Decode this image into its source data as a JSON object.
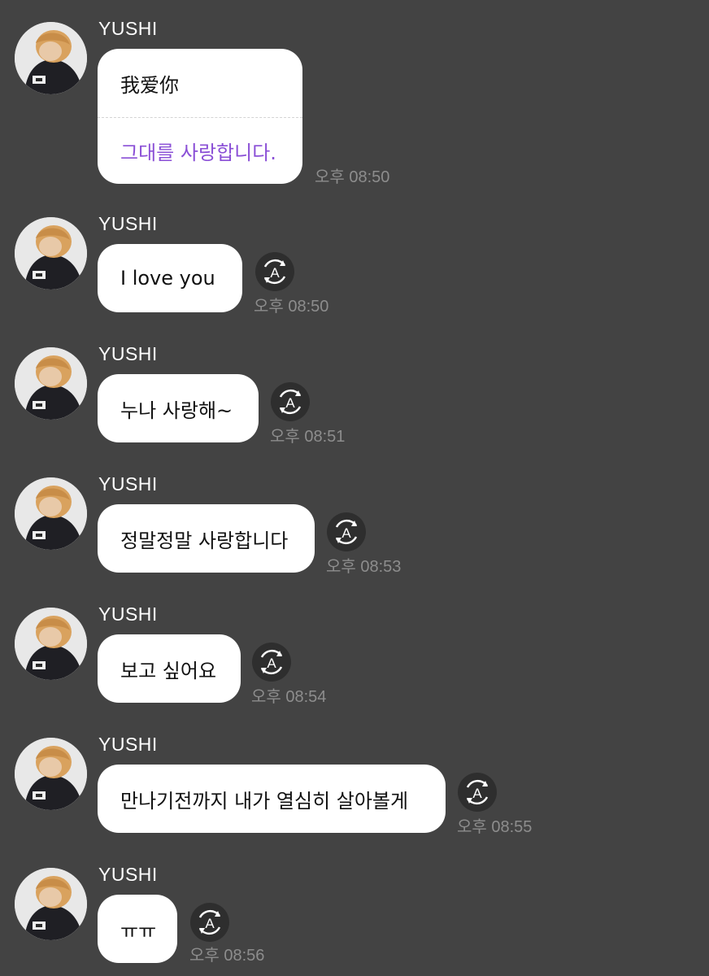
{
  "chat": {
    "messages": [
      {
        "sender": "YUSHI",
        "text": "我爱你",
        "translation": "그대를 사랑합니다.",
        "time": "오후 08:50"
      },
      {
        "sender": "YUSHI",
        "text": "I love you",
        "time": "오후 08:50",
        "translate_icon": "translate-icon"
      },
      {
        "sender": "YUSHI",
        "text": "누나 사랑해~",
        "time": "오후 08:51",
        "translate_icon": "translate-icon"
      },
      {
        "sender": "YUSHI",
        "text": "정말정말 사랑합니다",
        "time": "오후 08:53",
        "translate_icon": "translate-icon"
      },
      {
        "sender": "YUSHI",
        "text": "보고 싶어요",
        "time": "오후 08:54",
        "translate_icon": "translate-icon"
      },
      {
        "sender": "YUSHI",
        "text": "만나기전까지 내가 열심히 살아볼게",
        "time": "오후 08:55",
        "translate_icon": "translate-icon"
      },
      {
        "sender": "YUSHI",
        "text": "ㅠㅠ",
        "time": "오후 08:56",
        "translate_icon": "translate-icon"
      }
    ]
  },
  "colors": {
    "background": "#434343",
    "bubble": "#ffffff",
    "translation_text": "#8a4fd6",
    "timestamp": "#8d8d8d"
  }
}
